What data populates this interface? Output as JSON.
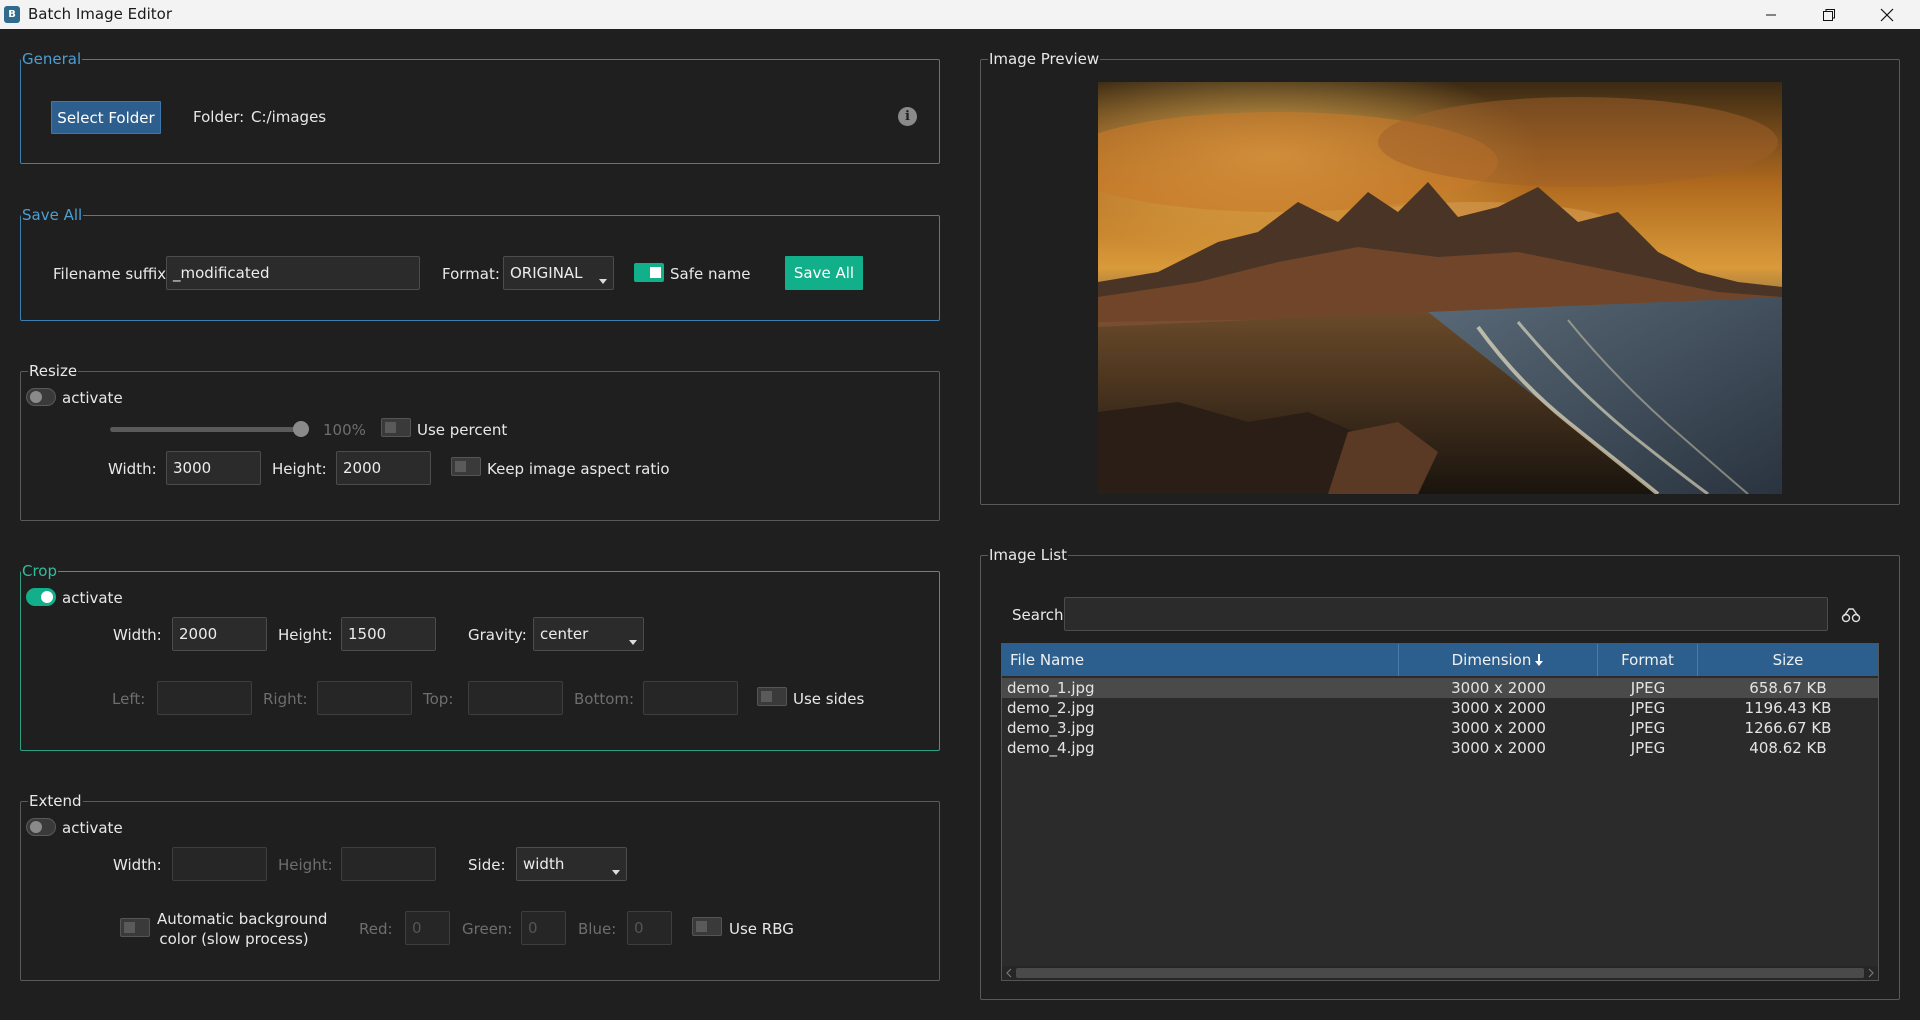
{
  "window": {
    "title": "Batch Image Editor",
    "icon_letter": "B",
    "minimize_icon": "minimize-icon",
    "maximize_icon": "restore-icon",
    "close_icon": "close-icon"
  },
  "general": {
    "legend": "General",
    "select_folder_label": "Select Folder",
    "folder_label": "Folder:",
    "folder_value": "C:/images",
    "info_icon": "info-icon"
  },
  "save_all": {
    "legend": "Save All",
    "suffix_label": "Filename suffix:",
    "suffix_value": "_modificated",
    "format_label": "Format:",
    "format_value": "ORIGINAL",
    "safe_name_label": "Safe name",
    "safe_name_on": true,
    "save_button_label": "Save All"
  },
  "resize": {
    "legend": "Resize",
    "activate_label": "activate",
    "active": false,
    "percent_value": "100%",
    "percent_fraction": 1.0,
    "use_percent_label": "Use percent",
    "width_label": "Width:",
    "width_value": "3000",
    "height_label": "Height:",
    "height_value": "2000",
    "keep_aspect_label": "Keep image aspect ratio"
  },
  "crop": {
    "legend": "Crop",
    "activate_label": "activate",
    "active": true,
    "width_label": "Width:",
    "width_value": "2000",
    "height_label": "Height:",
    "height_value": "1500",
    "gravity_label": "Gravity:",
    "gravity_value": "center",
    "left_label": "Left:",
    "right_label": "Right:",
    "top_label": "Top:",
    "bottom_label": "Bottom:",
    "use_sides_label": "Use sides"
  },
  "extend": {
    "legend": "Extend",
    "activate_label": "activate",
    "active": false,
    "width_label": "Width:",
    "height_label": "Height:",
    "side_label": "Side:",
    "side_value": "width",
    "auto_bg_label_1": "Automatic background",
    "auto_bg_label_2": "color (slow process)",
    "red_label": "Red:",
    "red_value": "0",
    "green_label": "Green:",
    "green_value": "0",
    "blue_label": "Blue:",
    "blue_value": "0",
    "use_rgb_label": "Use RBG"
  },
  "preview": {
    "legend": "Image Preview"
  },
  "image_list": {
    "legend": "Image List",
    "search_label": "Search",
    "search_value": "",
    "clear_icon": "clear-filter-icon",
    "columns": [
      "File Name",
      "Dimension",
      "Format",
      "Size"
    ],
    "sort_icon": "sort-down-arrow-icon",
    "rows": [
      {
        "name": "demo_1.jpg",
        "dimension": "3000 x 2000",
        "format": "JPEG",
        "size": "658.67 KB"
      },
      {
        "name": "demo_2.jpg",
        "dimension": "3000 x 2000",
        "format": "JPEG",
        "size": "1196.43 KB"
      },
      {
        "name": "demo_3.jpg",
        "dimension": "3000 x 2000",
        "format": "JPEG",
        "size": "1266.67 KB"
      },
      {
        "name": "demo_4.jpg",
        "dimension": "3000 x 2000",
        "format": "JPEG",
        "size": "408.62 KB"
      }
    ]
  },
  "colors": {
    "accent_blue": "#2d5f8e",
    "accent_teal": "#12b08a",
    "background": "#1f1f1f"
  }
}
